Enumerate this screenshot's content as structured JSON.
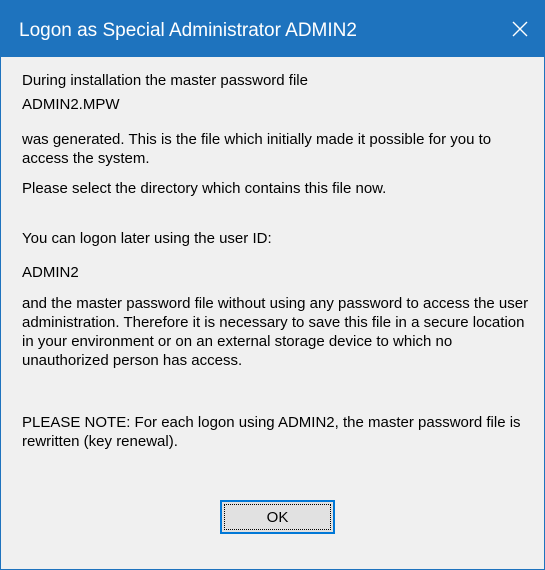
{
  "window": {
    "title": "Logon as Special Administrator ADMIN2",
    "close_icon": "close-icon"
  },
  "message": {
    "line1": "During installation the master password file",
    "filename": "ADMIN2.MPW",
    "generated_text": "was generated. This is the file which initially made it possible for you to access the system.",
    "select_text": "Please select the directory which contains this file now.",
    "logon_text": "You can logon later using the user ID:",
    "user_id": "ADMIN2",
    "storage_text": "and the master password file without using any password to access the user administration. Therefore it is necessary to save this file in a secure location in your environment or on an external storage device to which no unauthorized person has access.",
    "note_text": "PLEASE NOTE: For each logon using ADMIN2, the master password file is rewritten (key renewal)."
  },
  "buttons": {
    "ok_label": "OK"
  },
  "colors": {
    "titlebar": "#1e73be",
    "background": "#f0f0f0",
    "button_border": "#0078d7"
  }
}
